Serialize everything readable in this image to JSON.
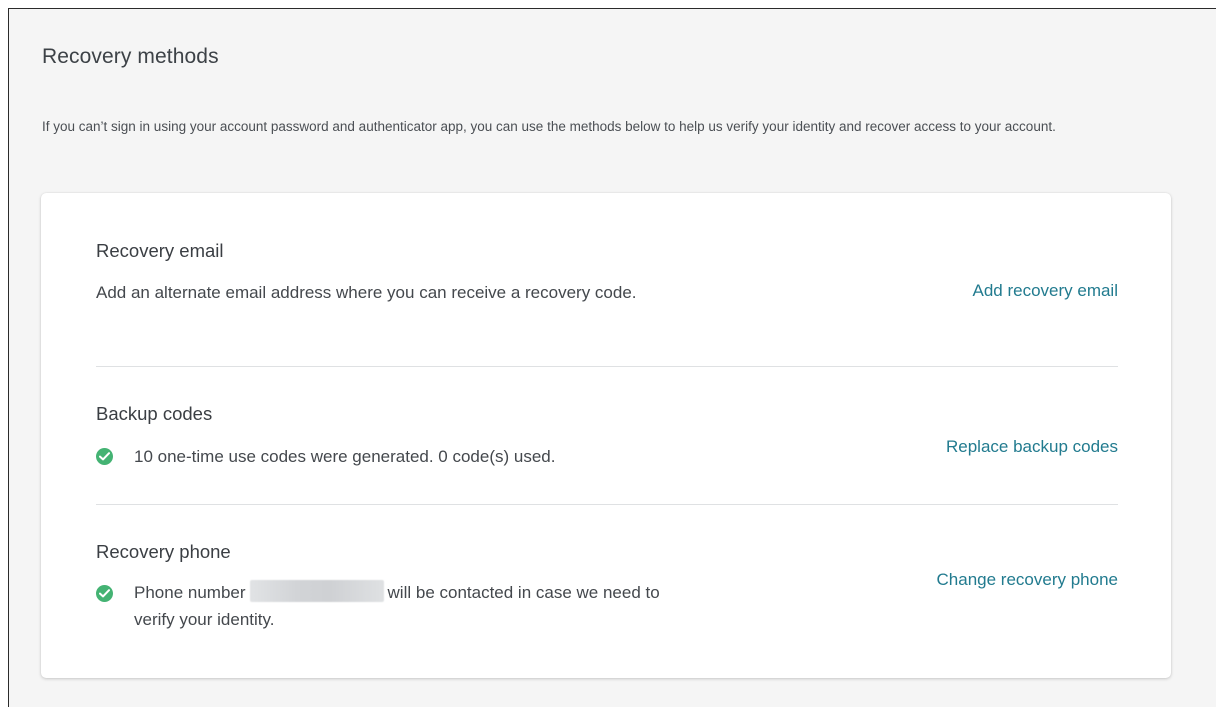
{
  "section": {
    "title": "Recovery methods",
    "description": "If you can’t sign in using your account password and authenticator app, you can use the methods below to help us verify your identity and recover access to your account."
  },
  "recovery_email": {
    "title": "Recovery email",
    "description": "Add an alternate email address where you can receive a recovery code.",
    "action": "Add recovery email"
  },
  "backup_codes": {
    "title": "Backup codes",
    "status_icon": "check-circle-icon",
    "status_text": "10 one-time use codes were generated. 0 code(s) used.",
    "action": "Replace backup codes"
  },
  "recovery_phone": {
    "title": "Recovery phone",
    "status_icon": "check-circle-icon",
    "status_text_before": "Phone number",
    "status_text_after": "will be contacted in case we need to verify your identity.",
    "action": "Change recovery phone"
  },
  "colors": {
    "accent_link": "#227b8f",
    "success": "#44b373",
    "page_background": "#f5f5f5",
    "card_background": "#ffffff"
  }
}
